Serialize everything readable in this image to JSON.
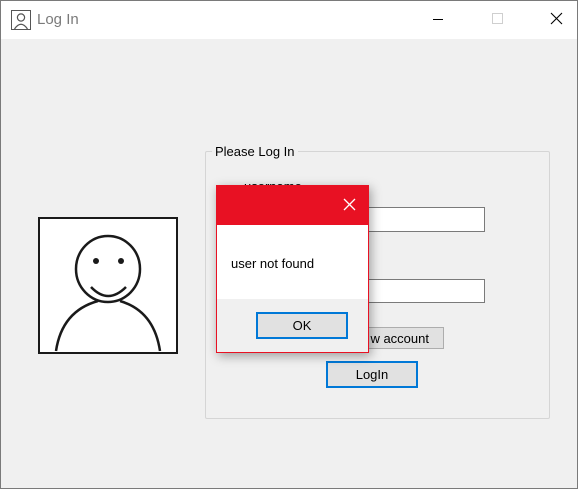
{
  "window": {
    "title": "Log In"
  },
  "titlebar_icons": {
    "app": "user-icon",
    "minimize": "minimize-icon",
    "maximize": "maximize-icon",
    "close": "close-icon"
  },
  "login_group": {
    "label": "Please Log In",
    "username_label": "username",
    "username_value": "",
    "password_value": "",
    "new_account_label": "w account",
    "login_button": "LogIn"
  },
  "avatar": {
    "icon": "smiley-person-drawing"
  },
  "message_box": {
    "message": "user not found",
    "ok_label": "OK",
    "accent_color": "#e81123"
  },
  "colors": {
    "focus_border": "#0078d7",
    "background": "#f0f0f0"
  }
}
